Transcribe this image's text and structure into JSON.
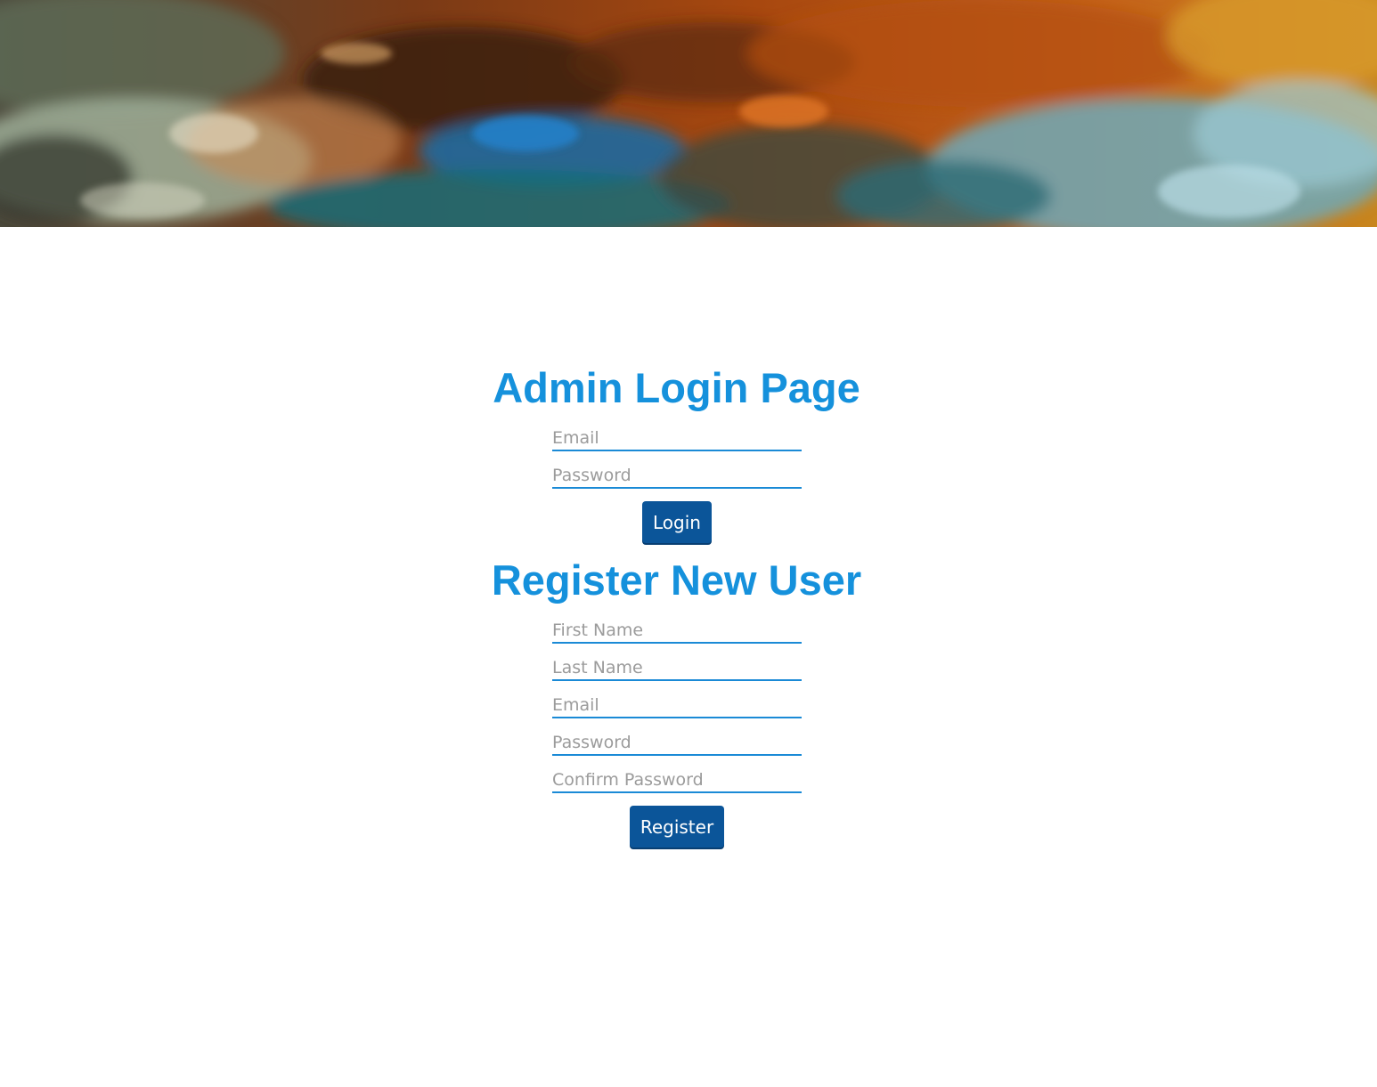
{
  "banner": {
    "description_icon": "abstract-painting-banner"
  },
  "login": {
    "title": "Admin Login Page",
    "email_placeholder": "Email",
    "password_placeholder": "Password",
    "button_label": "Login"
  },
  "register": {
    "title": "Register New User",
    "first_name_placeholder": "First Name",
    "last_name_placeholder": "Last Name",
    "email_placeholder": "Email",
    "password_placeholder": "Password",
    "confirm_password_placeholder": "Confirm Password",
    "button_label": "Register"
  },
  "colors": {
    "heading": "#1591dc",
    "button": "#0b5599",
    "underline": "#1a8ad6"
  }
}
